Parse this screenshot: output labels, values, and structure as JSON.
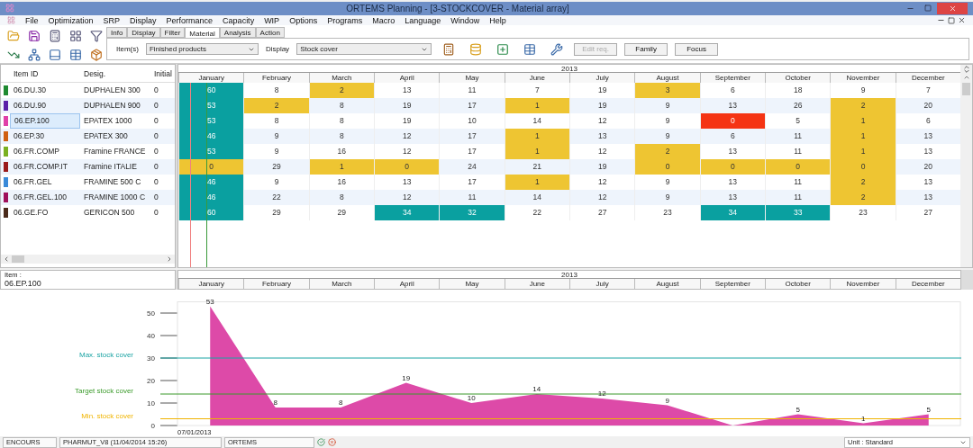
{
  "window": {
    "title": "ORTEMS  Planning - [3-STOCKCOVER - Material array]"
  },
  "menu": [
    "File",
    "Optimization",
    "SRP",
    "Display",
    "Performance",
    "Capacity",
    "WIP",
    "Options",
    "Programs",
    "Macro",
    "Language",
    "Window",
    "Help"
  ],
  "toolbar": {
    "tabs": [
      {
        "label": "Info",
        "selected": false
      },
      {
        "label": "Display",
        "selected": false
      },
      {
        "label": "Filter",
        "selected": false
      },
      {
        "label": "Material",
        "selected": true
      },
      {
        "label": "Analysis",
        "selected": false
      },
      {
        "label": "Action",
        "selected": false
      }
    ],
    "item_label": "Item(s)",
    "item_select": "Finished products",
    "display_label": "Display",
    "display_select": "Stock cover",
    "buttons": [
      {
        "label": "Edit req.",
        "disabled": true
      },
      {
        "label": "Family",
        "disabled": false
      },
      {
        "label": "Focus",
        "disabled": false
      }
    ]
  },
  "item_list": {
    "columns": [
      "Item ID",
      "Desig.",
      "Initial"
    ],
    "rows": [
      {
        "id": "06.DU.30",
        "desig": "DUPHALEN 300",
        "initial": "0",
        "color": "#1e8a30",
        "selected": false
      },
      {
        "id": "06.DU.90",
        "desig": "DUPHALEN 900",
        "initial": "0",
        "color": "#5a1fa8",
        "selected": false
      },
      {
        "id": "06.EP.100",
        "desig": "EPATEX 1000",
        "initial": "0",
        "color": "#e040a8",
        "selected": true
      },
      {
        "id": "06.EP.30",
        "desig": "EPATEX 300",
        "initial": "0",
        "color": "#d06010",
        "selected": false
      },
      {
        "id": "06.FR.COMP",
        "desig": "Framine FRANCE",
        "initial": "0",
        "color": "#7ab020",
        "selected": false
      },
      {
        "id": "06.FR.COMP.IT",
        "desig": "Framine ITALIE",
        "initial": "0",
        "color": "#9a1a1a",
        "selected": false
      },
      {
        "id": "06.FR.GEL",
        "desig": "FRAMINE 500 C",
        "initial": "0",
        "color": "#3a8ad8",
        "selected": false
      },
      {
        "id": "06.FR.GEL.100",
        "desig": "FRAMINE 1000 C",
        "initial": "0",
        "color": "#a0105a",
        "selected": false
      },
      {
        "id": "06.GE.FO",
        "desig": "GERICON 500",
        "initial": "0",
        "color": "#4a2a1a",
        "selected": false
      }
    ]
  },
  "grid": {
    "year": "2013",
    "months": [
      "January",
      "February",
      "March",
      "April",
      "May",
      "June",
      "July",
      "August",
      "September",
      "October",
      "November",
      "December"
    ],
    "rows": [
      {
        "cells": [
          {
            "text": "60",
            "kind": "high"
          },
          {
            "text": "8",
            "kind": "normal"
          },
          {
            "text": "2",
            "kind": "low"
          },
          {
            "text": "13",
            "kind": "normal"
          },
          {
            "text": "11",
            "kind": "normal"
          },
          {
            "text": "7",
            "kind": "normal"
          },
          {
            "text": "19",
            "kind": "normal"
          },
          {
            "text": "3",
            "kind": "low"
          },
          {
            "text": "6",
            "kind": "normal"
          },
          {
            "text": "18",
            "kind": "normal"
          },
          {
            "text": "9",
            "kind": "normal"
          },
          {
            "text": "7",
            "kind": "normal"
          }
        ]
      },
      {
        "cells": [
          {
            "text": "53",
            "kind": "high"
          },
          {
            "text": "2",
            "kind": "low"
          },
          {
            "text": "8",
            "kind": "normal"
          },
          {
            "text": "19",
            "kind": "normal"
          },
          {
            "text": "17",
            "kind": "normal"
          },
          {
            "text": "1",
            "kind": "low"
          },
          {
            "text": "19",
            "kind": "normal"
          },
          {
            "text": "9",
            "kind": "normal"
          },
          {
            "text": "13",
            "kind": "normal"
          },
          {
            "text": "26",
            "kind": "normal"
          },
          {
            "text": "2",
            "kind": "low"
          },
          {
            "text": "20",
            "kind": "normal"
          }
        ]
      },
      {
        "cells": [
          {
            "text": "53",
            "kind": "high"
          },
          {
            "text": "8",
            "kind": "normal"
          },
          {
            "text": "8",
            "kind": "normal"
          },
          {
            "text": "19",
            "kind": "normal"
          },
          {
            "text": "10",
            "kind": "normal"
          },
          {
            "text": "14",
            "kind": "normal"
          },
          {
            "text": "12",
            "kind": "normal"
          },
          {
            "text": "9",
            "kind": "normal"
          },
          {
            "text": "0",
            "kind": "empty"
          },
          {
            "text": "5",
            "kind": "normal"
          },
          {
            "text": "1",
            "kind": "low"
          },
          {
            "text": "6",
            "kind": "normal"
          }
        ]
      },
      {
        "cells": [
          {
            "text": "46",
            "kind": "high"
          },
          {
            "text": "9",
            "kind": "normal"
          },
          {
            "text": "8",
            "kind": "normal"
          },
          {
            "text": "12",
            "kind": "normal"
          },
          {
            "text": "17",
            "kind": "normal"
          },
          {
            "text": "1",
            "kind": "low"
          },
          {
            "text": "13",
            "kind": "normal"
          },
          {
            "text": "9",
            "kind": "normal"
          },
          {
            "text": "6",
            "kind": "normal"
          },
          {
            "text": "11",
            "kind": "normal"
          },
          {
            "text": "1",
            "kind": "low"
          },
          {
            "text": "13",
            "kind": "normal"
          }
        ]
      },
      {
        "cells": [
          {
            "text": "53",
            "kind": "high"
          },
          {
            "text": "9",
            "kind": "normal"
          },
          {
            "text": "16",
            "kind": "normal"
          },
          {
            "text": "12",
            "kind": "normal"
          },
          {
            "text": "17",
            "kind": "normal"
          },
          {
            "text": "1",
            "kind": "low"
          },
          {
            "text": "12",
            "kind": "normal"
          },
          {
            "text": "2",
            "kind": "low"
          },
          {
            "text": "13",
            "kind": "normal"
          },
          {
            "text": "11",
            "kind": "normal"
          },
          {
            "text": "1",
            "kind": "low"
          },
          {
            "text": "13",
            "kind": "normal"
          }
        ]
      },
      {
        "cells": [
          {
            "text": "0",
            "kind": "low"
          },
          {
            "text": "29",
            "kind": "normal"
          },
          {
            "text": "1",
            "kind": "low"
          },
          {
            "text": "0",
            "kind": "low"
          },
          {
            "text": "24",
            "kind": "normal"
          },
          {
            "text": "21",
            "kind": "normal"
          },
          {
            "text": "19",
            "kind": "normal"
          },
          {
            "text": "0",
            "kind": "low"
          },
          {
            "text": "0",
            "kind": "low"
          },
          {
            "text": "0",
            "kind": "low"
          },
          {
            "text": "0",
            "kind": "low"
          },
          {
            "text": "20",
            "kind": "normal"
          }
        ]
      },
      {
        "cells": [
          {
            "text": "46",
            "kind": "high"
          },
          {
            "text": "9",
            "kind": "normal"
          },
          {
            "text": "16",
            "kind": "normal"
          },
          {
            "text": "13",
            "kind": "normal"
          },
          {
            "text": "17",
            "kind": "normal"
          },
          {
            "text": "1",
            "kind": "low"
          },
          {
            "text": "12",
            "kind": "normal"
          },
          {
            "text": "9",
            "kind": "normal"
          },
          {
            "text": "13",
            "kind": "normal"
          },
          {
            "text": "11",
            "kind": "normal"
          },
          {
            "text": "2",
            "kind": "low"
          },
          {
            "text": "13",
            "kind": "normal"
          }
        ]
      },
      {
        "cells": [
          {
            "text": "46",
            "kind": "high"
          },
          {
            "text": "22",
            "kind": "normal"
          },
          {
            "text": "8",
            "kind": "normal"
          },
          {
            "text": "12",
            "kind": "normal"
          },
          {
            "text": "11",
            "kind": "normal"
          },
          {
            "text": "14",
            "kind": "normal"
          },
          {
            "text": "12",
            "kind": "normal"
          },
          {
            "text": "9",
            "kind": "normal"
          },
          {
            "text": "13",
            "kind": "normal"
          },
          {
            "text": "11",
            "kind": "normal"
          },
          {
            "text": "2",
            "kind": "low"
          },
          {
            "text": "13",
            "kind": "normal"
          }
        ]
      },
      {
        "cells": [
          {
            "text": "60",
            "kind": "high"
          },
          {
            "text": "29",
            "kind": "normal"
          },
          {
            "text": "29",
            "kind": "normal"
          },
          {
            "text": "34",
            "kind": "high"
          },
          {
            "text": "32",
            "kind": "high"
          },
          {
            "text": "22",
            "kind": "normal"
          },
          {
            "text": "27",
            "kind": "normal"
          },
          {
            "text": "23",
            "kind": "normal"
          },
          {
            "text": "34",
            "kind": "high"
          },
          {
            "text": "33",
            "kind": "high"
          },
          {
            "text": "23",
            "kind": "normal"
          },
          {
            "text": "27",
            "kind": "normal"
          }
        ]
      }
    ]
  },
  "detail": {
    "item_label": "Item :",
    "item_value": "06.EP.100",
    "year": "2013",
    "date": "07/01/2013",
    "chart_data": {
      "type": "area",
      "categories": [
        "January",
        "February",
        "March",
        "April",
        "May",
        "June",
        "July",
        "August",
        "September",
        "October",
        "November",
        "December"
      ],
      "series": [
        {
          "color": "#dd4aa8",
          "values": [
            53,
            8,
            8,
            19,
            10,
            14,
            12,
            9,
            0,
            5,
            1,
            5
          ]
        }
      ],
      "ylim": [
        0,
        55
      ],
      "yticks": [
        0,
        10,
        20,
        30,
        40,
        50
      ],
      "value_labels": [
        "53",
        "8",
        "8",
        "19",
        "10",
        "14",
        "12",
        "9",
        null,
        "5",
        "1",
        "5"
      ],
      "ref_lines": [
        {
          "axis": "y",
          "label": "Max. stock cover",
          "value": 30,
          "color": "#1aa3a3"
        },
        {
          "axis": "y",
          "label": "Target stock cover",
          "value": 14,
          "color": "#3a9a2a"
        },
        {
          "axis": "y",
          "label": "Min. stock cover",
          "value": 3,
          "color": "#f0b400"
        }
      ]
    }
  },
  "status_bar": {
    "fields": [
      "ENCOURS",
      "PHARMUT_V8 (11/04/2014 15:26)",
      "ORTEMS"
    ],
    "unit": "Unit : Standard"
  }
}
